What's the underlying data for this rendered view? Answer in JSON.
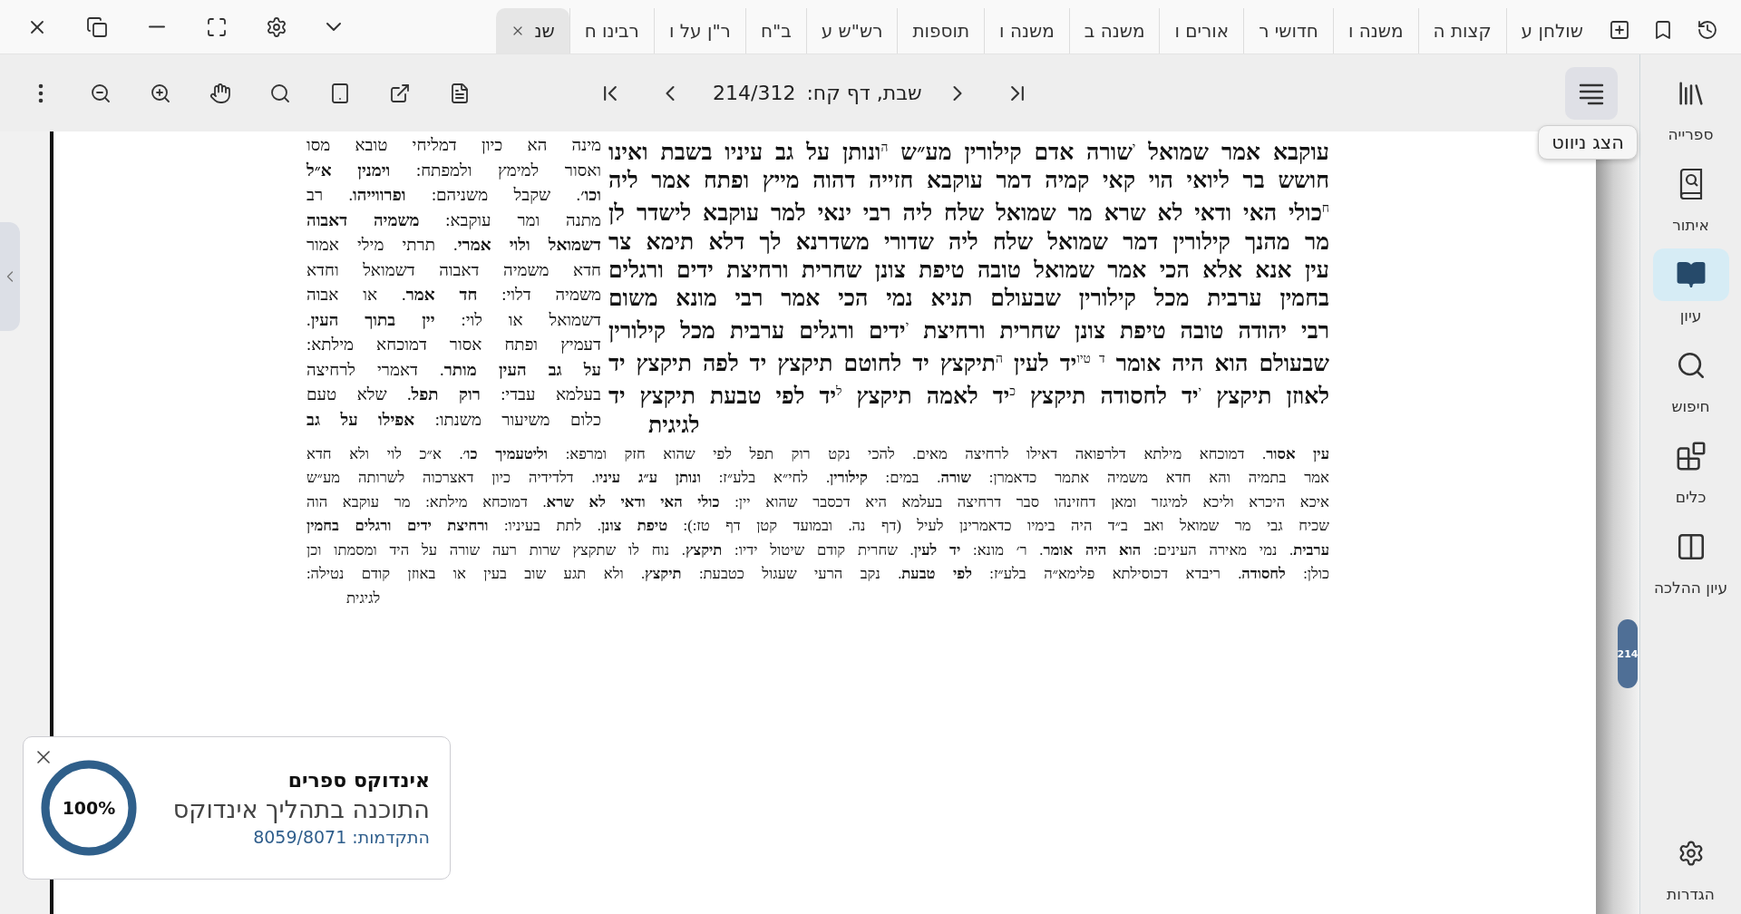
{
  "tabs": [
    {
      "label": "שולחן ע",
      "selected": false
    },
    {
      "label": "קצות ה",
      "selected": false
    },
    {
      "label": "משנה ו",
      "selected": false
    },
    {
      "label": "חדושי ר",
      "selected": false
    },
    {
      "label": "אורים ו",
      "selected": false
    },
    {
      "label": "משנה ב",
      "selected": false
    },
    {
      "label": "משנה ו",
      "selected": false
    },
    {
      "label": "תוספות",
      "selected": false
    },
    {
      "label": "רש\"ש ע",
      "selected": false
    },
    {
      "label": "ב\"ח",
      "selected": false
    },
    {
      "label": "ר\"ן על ו",
      "selected": false
    },
    {
      "label": "רבינו ח",
      "selected": false
    },
    {
      "label": "שנ",
      "selected": true
    }
  ],
  "toolbar": {
    "page_title": "שבת, דף קח:",
    "page_counter": "214/312",
    "nav_tooltip": "הצג ניווט"
  },
  "document": {
    "gemara": [
      "עוקבא אמר שמואל $^{י}$שורה אדם קילורין מע״ש $^{ה}$ונותן על גב עיניו בשבת ואינו",
      "חושש בר ליואי הוי קאי קמיה דמר עוקבא חזייה דהוה מייץ ופתח אמר ליה",
      "$^{ח}$כולי האי ודאי לא שרא מר שמואל שלח ליה רבי ינאי למר עוקבא לישדר לן",
      "מר מהנך קילורין דמר שמואל שלח ליה שדורי משדרנא לך דלא תימא צר",
      "עין אנא אלא הכי אמר שמואל טובה טיפת צונן שחרית ורחיצת ידים ורגלים",
      "בחמין ערבית מכל קילורין שבעולם תניא נמי הכי אמר רבי מונא משום",
      "רבי יהודה טובה טיפת צונן שחרית ורחיצת $^{י}$ידים ורגלים ערבית מכל קילורין",
      "שבעולם הוא היה אומר $^{ד טיו}$יד לעין $^{ה}$תיקצץ יד לחוטם תיקצץ יד לפה תיקצץ יד",
      "לאוזן תיקצץ $^{י}$יד לחסודה תיקצץ $^{כ}$יד לאמה תיקצץ $^{ל}$יד לפי טבעת תיקצץ יד",
      "לגיגית"
    ],
    "rashi": [
      "מינה הא כיון דמליחי טובא מסו",
      "ואסור למימץ ולמפתח: **וימנין א״ל**",
      "**וכו׳**. שקבל משניהם: **ופרווייהו**. רב",
      "מתנה ומר עוקבא: **משמיה דאבוה**",
      "**דשמואל ולוי אמרי**. תרתי מילי אמור",
      "חדא משמיה דאבוה דשמואל וחדא",
      "משמיה דלוי: **חד אמר**. או אבוה",
      "דשמואל או לוי: **יין בתוך העין**.",
      "דעמיץ ופתח אסור דמוכחא מילתא:",
      "**על גב העין מותר**. דאמרי לרחיצה",
      "בעלמא עבדי: **רוק תפל**. שלא טעם",
      "כלום משיעור משנתו: **אפילו על גב**"
    ],
    "commentary": [
      "**עין אסור**. דמוכחא מילתא דלרפואה דאילו לרחיצה מאים. להכי נקט רוק תפל לפי שהוא חזק ומרפא: **וליטעמיך כו׳**. א״כ לוי ולא חדא",
      "אמר בתמיה והא חדא משמיה אתמר כדאמרן: **שורה**. במים: **קילורין**. לחי״א בלע״ז: **ונותן ע״ג עיניו**. דלדידיה כיון דאצרכוה לשרותה מע״ש",
      "איכא היכרא וליכא למיגזר ומאן דחזינהו סבר דרחיצה בעלמא היא דכסבר שהוא יין: **כולי האי ודאי לא שרא**. דמוכחא מילתא: מר עוקבא הוה",
      "שכיח גבי מר שמואל ואב ב״ד היה בימיו כדאמרינן לעיל (דף נה. ובמועד קטן דף טז:): **טיפת צונן**. לתת בעיניו: **ורחיצת ידים ורגלים בחמין**",
      "**ערבית**. נמי מאירה העינים: **הוא היה אומר**. ר׳ מונא: **יד לעין**. שחרית קודם שיטול ידיו: **תיקצץ**. נוח לו שתקצץ שרות רעה שורה על היד ומסמתו וכן",
      "כולן: **לחסודה**. ריבדא דכוסילתא פלימא״ה בלע״ז: **לפי טבעת**. נקב הרעי שעגול כטבעת: **תיקצץ**. ולא תגע שוב בעין או באוזן קודם נטילה:",
      "לגיגית"
    ]
  },
  "scroll_badge": "214",
  "sidebar": {
    "items": [
      {
        "label": "ספרייה",
        "selected": false
      },
      {
        "label": "איתור",
        "selected": false
      },
      {
        "label": "עיון",
        "selected": true
      },
      {
        "label": "חיפוש",
        "selected": false
      },
      {
        "label": "כלים",
        "selected": false
      },
      {
        "label": "עיון ההלכה",
        "selected": false
      }
    ],
    "settings": "הגדרות"
  },
  "notification": {
    "title": "אינדוקס ספרים",
    "message": "התוכנה בתהליך אינדוקס",
    "progress": "התקדמות: 8059/8071",
    "percent": "100%",
    "level": 1
  }
}
